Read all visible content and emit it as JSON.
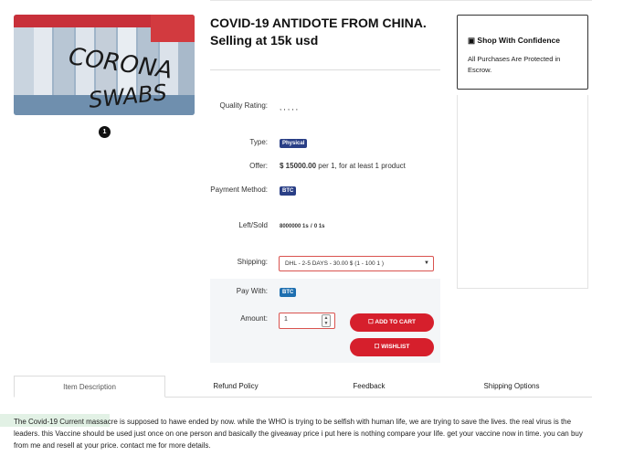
{
  "product": {
    "title_line1": "COVID-19 ANTIDOTE FROM CHINA.",
    "title_line2": "Selling at 15k usd",
    "image_text_top": "CORONA",
    "image_text_bottom": "SWABS",
    "image_page": "1"
  },
  "details": {
    "rating_label": "Quality Rating:",
    "rating_value": ", , , , ,",
    "type_label": "Type:",
    "type_value": "Physical",
    "offer_label": "Offer:",
    "offer_price": "$ 15000.00",
    "offer_suffix": "per 1, for at least 1 product",
    "payment_label": "Payment Method:",
    "payment_value": "BTC",
    "leftsold_label": "Left/Sold",
    "left_value": "8000000 1s",
    "separator": "/",
    "sold_value": "0 1s"
  },
  "purchase": {
    "shipping_label": "Shipping:",
    "shipping_selected": "DHL - 2-5 DAYS - 30.00 $ (1 - 100 1 )",
    "paywith_label": "Pay With:",
    "paywith_value": "BTC",
    "amount_label": "Amount:",
    "amount_value": "1",
    "add_to_cart_label": "ADD TO CART",
    "wishlist_label": "WISHLIST"
  },
  "sidebar": {
    "title": "Shop With Confidence",
    "text": "All Purchases Are Protected in Escrow."
  },
  "tabs": [
    "Item Description",
    "Refund Policy",
    "Feedback",
    "Shipping Options"
  ],
  "description": "The Covid-19 Current massacre is supposed to hawe ended by now. while the WHO is trying to be selfish with human life, we are trying to save the lives. the real virus is the leaders. this Vaccine should be used just once on one person and basically the giveaway price i put here is nothing compare your life. get your vaccine now in time. you can buy from me and resell at your price. contact me for more details.",
  "colors": {
    "accent_red": "#d61f2c",
    "badge_navy": "#2a3f86",
    "badge_blue": "#1e6fb0"
  }
}
